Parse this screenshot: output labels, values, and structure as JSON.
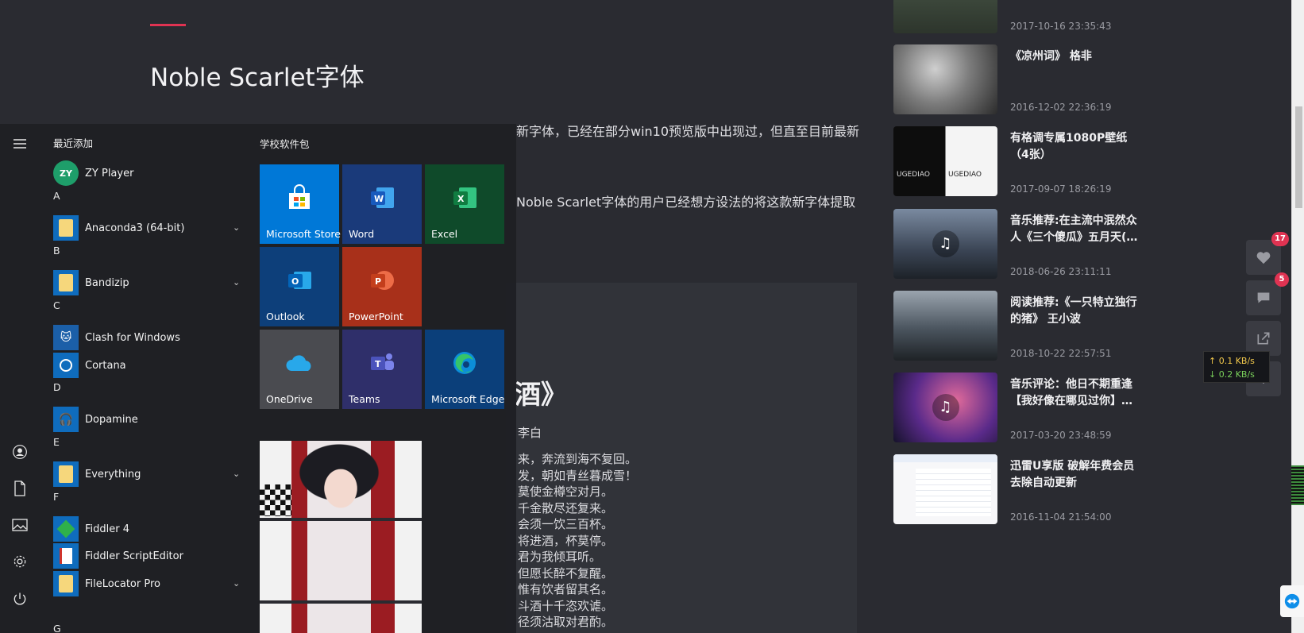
{
  "blog": {
    "title": "Noble Scarlet字体",
    "paragraph1_tail": "新字体，已经在部分win10预览版中出现过，但直至目前最新",
    "paragraph2_tail": "Noble Scarlet字体的用户已经想方设法的将这款新字体提取",
    "poem_title_tail": "酒》",
    "poem_author_tail": "李白",
    "poem_lines": [
      "来，奔流到海不复回。",
      "发，朝如青丝暮成雪！",
      "莫使金樽空对月。",
      "千金散尽还复来。",
      "会须一饮三百杯。",
      "将进酒，杯莫停。",
      "君为我倾耳听。",
      "但愿长醉不复醒。",
      "惟有饮者留其名。",
      "斗酒十千恣欢谑。",
      "径须沽取对君酌。"
    ]
  },
  "posts": [
    {
      "title": "",
      "date": "2017-10-16 23:35:43"
    },
    {
      "title": "《凉州词》 格非",
      "date": "2016-12-02 22:36:19"
    },
    {
      "title": "有格调专属1080P壁纸（4张）",
      "date": "2017-09-07 18:26:19",
      "thumb_text": "UGEDIAO"
    },
    {
      "title": "音乐推荐:在主流中泯然众人《三个傻瓜》五月天(…",
      "date": "2018-06-26 23:11:11"
    },
    {
      "title": "阅读推荐:《一只特立独行的猪》 王小波",
      "date": "2018-10-22 22:57:51"
    },
    {
      "title": "音乐评论：他日不期重逢【我好像在哪见过你】…",
      "date": "2017-03-20 23:48:59"
    },
    {
      "title": "迅雷U享版 破解年费会员 去除自动更新",
      "date": "2016-11-04 21:54:00"
    }
  ],
  "fabs": {
    "like_count": "17",
    "comment_count": "5"
  },
  "netspeed": {
    "up": "↑ 0.1 KB/s",
    "down": "↓ 0.2 KB/s"
  },
  "start_menu": {
    "recent_label": "最近添加",
    "tiles_label": "学校软件包",
    "apps": [
      {
        "letter": "",
        "name": "ZY Player"
      },
      {
        "letter": "A",
        "name": "Anaconda3 (64-bit)"
      },
      {
        "letter": "B",
        "name": "Bandizip"
      },
      {
        "letter": "C",
        "name": "Clash for Windows"
      },
      {
        "letter": "",
        "name": "Cortana"
      },
      {
        "letter": "D",
        "name": "Dopamine"
      },
      {
        "letter": "E",
        "name": "Everything"
      },
      {
        "letter": "F",
        "name": "Fiddler 4"
      },
      {
        "letter": "",
        "name": "Fiddler ScriptEditor"
      },
      {
        "letter": "",
        "name": "FileLocator Pro"
      },
      {
        "letter": "G",
        "name": ""
      }
    ],
    "tiles": [
      {
        "label": "Microsoft Store",
        "color": "#0078d7"
      },
      {
        "label": "Word",
        "color": "#1a3a7a"
      },
      {
        "label": "Excel",
        "color": "#0f4a2a"
      },
      {
        "label": "Outlook",
        "color": "#0d3f7a"
      },
      {
        "label": "PowerPoint",
        "color": "#a8301a"
      },
      {
        "label": "OneDrive",
        "color": "#4a4b50"
      },
      {
        "label": "Teams",
        "color": "#2f2f6a"
      },
      {
        "label": "Microsoft Edge",
        "color": "#0b3f7a"
      }
    ]
  }
}
